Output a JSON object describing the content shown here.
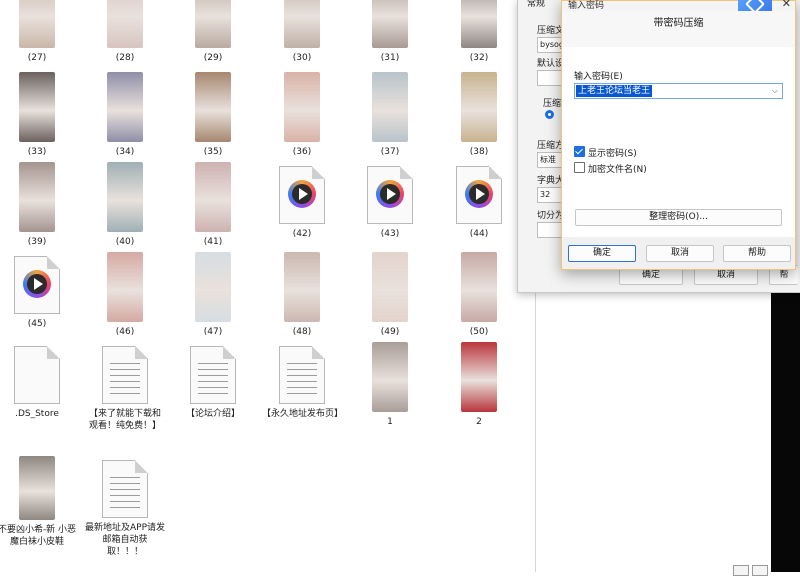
{
  "explorer": {
    "items": [
      {
        "label": "(27)",
        "kind": "photo",
        "color": "#c9b7a8"
      },
      {
        "label": "(28)",
        "kind": "photo",
        "color": "#d8c4c0"
      },
      {
        "label": "(29)",
        "kind": "photo",
        "color": "#b9aaa0"
      },
      {
        "label": "(30)",
        "kind": "photo",
        "color": "#bfb1a6"
      },
      {
        "label": "(31)",
        "kind": "photo",
        "color": "#a89a95"
      },
      {
        "label": "(32)",
        "kind": "photo",
        "color": "#8d8783"
      },
      {
        "label": "(33)",
        "kind": "photo",
        "color": "#6b6260"
      },
      {
        "label": "(34)",
        "kind": "photo",
        "color": "#8f8ea8"
      },
      {
        "label": "(35)",
        "kind": "photo",
        "color": "#a68770"
      },
      {
        "label": "(36)",
        "kind": "photo",
        "color": "#d9b2a7"
      },
      {
        "label": "(37)",
        "kind": "photo",
        "color": "#b8c3ca"
      },
      {
        "label": "(38)",
        "kind": "photo",
        "color": "#c8b38f"
      },
      {
        "label": "(39)",
        "kind": "photo",
        "color": "#a59490"
      },
      {
        "label": "(40)",
        "kind": "photo",
        "color": "#9fb0b4"
      },
      {
        "label": "(41)",
        "kind": "photo",
        "color": "#cdb2b0"
      },
      {
        "label": "(42)",
        "kind": "video"
      },
      {
        "label": "(43)",
        "kind": "video"
      },
      {
        "label": "(44)",
        "kind": "video"
      },
      {
        "label": "(45)",
        "kind": "video"
      },
      {
        "label": "(46)",
        "kind": "photo",
        "color": "#d5a9a3"
      },
      {
        "label": "(47)",
        "kind": "photo",
        "color": "#d6dde2"
      },
      {
        "label": "(48)",
        "kind": "photo",
        "color": "#cbb8b0"
      },
      {
        "label": "(49)",
        "kind": "photo",
        "color": "#e3d3cc"
      },
      {
        "label": "(50)",
        "kind": "photo",
        "color": "#c6a9a5"
      },
      {
        "label": ".DS_Store",
        "kind": "blank"
      },
      {
        "label": "【来了就能下载和观看！纯免费！】",
        "kind": "doc"
      },
      {
        "label": "【论坛介绍】",
        "kind": "doc"
      },
      {
        "label": "【永久地址发布页】",
        "kind": "doc"
      },
      {
        "label": "1",
        "kind": "photo",
        "color": "#a99d98"
      },
      {
        "label": "2",
        "kind": "photo",
        "color": "#b9353c"
      },
      {
        "label": "不要凶小希-新 小恶魔白袜小皮鞋",
        "kind": "photo",
        "color": "#8f8781"
      },
      {
        "label": "最新地址及APP请发邮箱自动获取！！！",
        "kind": "doc"
      }
    ]
  },
  "bg_dialog": {
    "tab": "常规",
    "compress_file_label": "压缩文",
    "filename_value": "bysog.",
    "default_label": "默认设",
    "format_label": "压缩",
    "method_label": "压缩方",
    "method_value": "标准",
    "dict_label": "字典大",
    "dict_value": "32",
    "split_label": "切分为",
    "ok": "确定",
    "cancel": "取消",
    "help_frag": "帮"
  },
  "pw_dialog": {
    "title_frag": "输入密码",
    "header": "带密码压缩",
    "input_label": "输入密码(E)",
    "password_value": "上老王论坛当老王",
    "show_password": {
      "label": "显示密码(S)",
      "checked": true
    },
    "encrypt_names": {
      "label": "加密文件名(N)",
      "checked": false
    },
    "manage": "整理密码(O)...",
    "ok": "确定",
    "cancel": "取消",
    "help": "帮助"
  }
}
